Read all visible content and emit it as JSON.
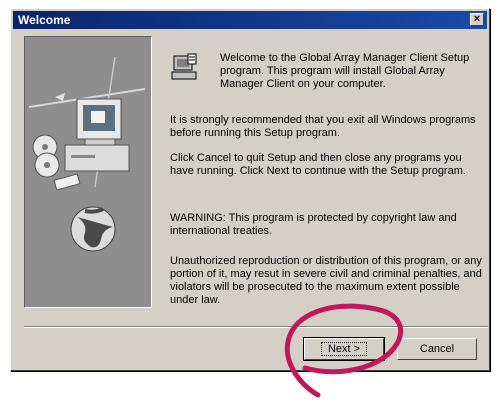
{
  "window": {
    "title": "Welcome",
    "close_label": "×"
  },
  "content": {
    "welcome_text": "Welcome to the Global Array Manager Client Setup program.  This program will install Global Array Manager Client on your computer.",
    "paragraph_1": "It is strongly recommended that you exit all Windows programs before running this Setup program.",
    "paragraph_2": "Click Cancel to quit Setup and then close any programs you have running.  Click Next to continue with the Setup program.",
    "warning": "WARNING: This program is protected by copyright law and international treaties.",
    "paragraph_3": "Unauthorized reproduction or distribution of this program, or any portion of it, may resut in severe civil and criminal penalties, and violators will be prosecuted to the maximum extent possible under law."
  },
  "buttons": {
    "next_label": "Next >",
    "cancel_label": "Cancel"
  },
  "icons": {
    "setup": "setup-computer-icon",
    "close": "close-icon"
  },
  "colors": {
    "titlebar": "#0a246a",
    "dialog_face": "#d4d0c8",
    "annotation": "#c0185a"
  }
}
